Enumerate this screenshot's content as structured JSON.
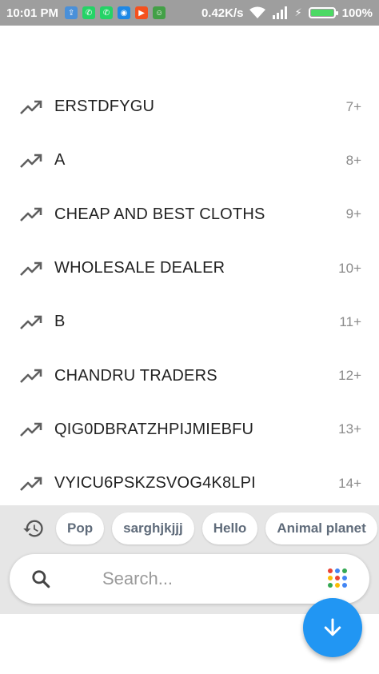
{
  "status_bar": {
    "time": "10:01 PM",
    "network_speed": "0.42K/s",
    "battery_percent": "100%",
    "battery_level": 1.0,
    "notification_icons": [
      {
        "name": "upload-app-icon",
        "color": "#4a90d9",
        "glyph": "⇪"
      },
      {
        "name": "whatsapp-icon",
        "color": "#25d366",
        "glyph": "✆"
      },
      {
        "name": "whatsapp-icon-2",
        "color": "#25d366",
        "glyph": "✆"
      },
      {
        "name": "camera-app-icon",
        "color": "#1e88e5",
        "glyph": "◉"
      },
      {
        "name": "video-app-icon",
        "color": "#f4511e",
        "glyph": "▶"
      },
      {
        "name": "android-app-icon",
        "color": "#43a047",
        "glyph": "☺"
      }
    ]
  },
  "trending": [
    {
      "label": "ERSTDFYGU",
      "rank": "7+"
    },
    {
      "label": "A",
      "rank": "8+"
    },
    {
      "label": "CHEAP AND BEST CLOTHS",
      "rank": "9+"
    },
    {
      "label": "WHOLESALE DEALER",
      "rank": "10+"
    },
    {
      "label": "B",
      "rank": "11+"
    },
    {
      "label": "CHANDRU TRADERS",
      "rank": "12+"
    },
    {
      "label": "QIG0DBRATZHPIJMIEBFU",
      "rank": "13+"
    },
    {
      "label": "VYICU6PSKZSVOG4K8LPI",
      "rank": "14+"
    }
  ],
  "recent_chips": [
    "Pop",
    "sarghjkjjj",
    "Hello",
    "Animal planet"
  ],
  "search": {
    "placeholder": "Search...",
    "value": ""
  },
  "colors": {
    "fab": "#2196f3",
    "chip_text": "#5f6b7a",
    "dots": [
      "#ea4335",
      "#4285f4",
      "#34a853",
      "#fbbc05",
      "#ea4335",
      "#4285f4",
      "#34a853",
      "#fbbc05",
      "#4285f4"
    ]
  }
}
